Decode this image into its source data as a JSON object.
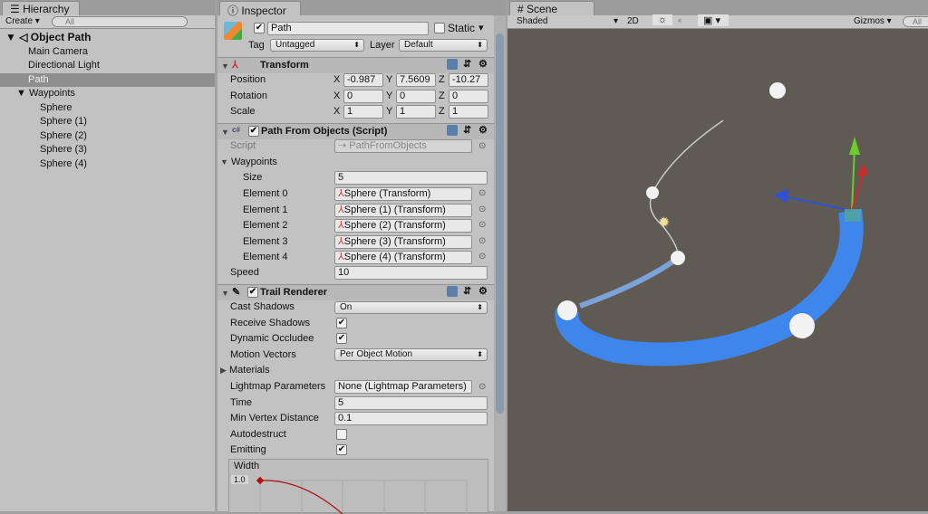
{
  "hierarchy": {
    "tab": "Hierarchy",
    "create": "Create",
    "search_placeholder": "All",
    "scene": "Object Path",
    "items": [
      {
        "label": "Main Camera"
      },
      {
        "label": "Directional Light"
      },
      {
        "label": "Path",
        "selected": true
      },
      {
        "label": "Waypoints"
      },
      {
        "label": "Sphere"
      },
      {
        "label": "Sphere (1)"
      },
      {
        "label": "Sphere (2)"
      },
      {
        "label": "Sphere (3)"
      },
      {
        "label": "Sphere (4)"
      }
    ]
  },
  "inspector": {
    "tab": "Inspector",
    "name": "Path",
    "active": true,
    "static_label": "Static",
    "static": false,
    "tag_label": "Tag",
    "tag": "Untagged",
    "layer_label": "Layer",
    "layer": "Default",
    "transform": {
      "title": "Transform",
      "rows": [
        {
          "label": "Position",
          "x": "-0.987",
          "y": "7.5609",
          "z": "-10.27"
        },
        {
          "label": "Rotation",
          "x": "0",
          "y": "0",
          "z": "0"
        },
        {
          "label": "Scale",
          "x": "1",
          "y": "1",
          "z": "1"
        }
      ]
    },
    "path": {
      "title": "Path From Objects (Script)",
      "script_label": "Script",
      "script": "PathFromObjects",
      "waypoints_label": "Waypoints",
      "size_label": "Size",
      "size": "5",
      "elements": [
        {
          "label": "Element 0",
          "value": "Sphere (Transform)"
        },
        {
          "label": "Element 1",
          "value": "Sphere (1) (Transform)"
        },
        {
          "label": "Element 2",
          "value": "Sphere (2) (Transform)"
        },
        {
          "label": "Element 3",
          "value": "Sphere (3) (Transform)"
        },
        {
          "label": "Element 4",
          "value": "Sphere (4) (Transform)"
        }
      ],
      "speed_label": "Speed",
      "speed": "10"
    },
    "trail": {
      "title": "Trail Renderer",
      "cast_shadows_label": "Cast Shadows",
      "cast_shadows": "On",
      "receive_shadows_label": "Receive Shadows",
      "dynamic_occludee_label": "Dynamic Occludee",
      "motion_vectors_label": "Motion Vectors",
      "motion_vectors": "Per Object Motion",
      "materials_label": "Materials",
      "lightmap_label": "Lightmap Parameters",
      "lightmap": "None (Lightmap Parameters)",
      "time_label": "Time",
      "time": "5",
      "min_vertex_label": "Min Vertex Distance",
      "min_vertex": "0.1",
      "autodestruct_label": "Autodestruct",
      "emitting_label": "Emitting",
      "width_label": "Width",
      "width_value": "1.0"
    }
  },
  "scene": {
    "tab": "Scene",
    "shading": "Shaded",
    "mode_2d": "2D",
    "gizmos": "Gizmos",
    "search_placeholder": "All",
    "trail_color": "#3f86ec",
    "background": "#5f5a54"
  }
}
